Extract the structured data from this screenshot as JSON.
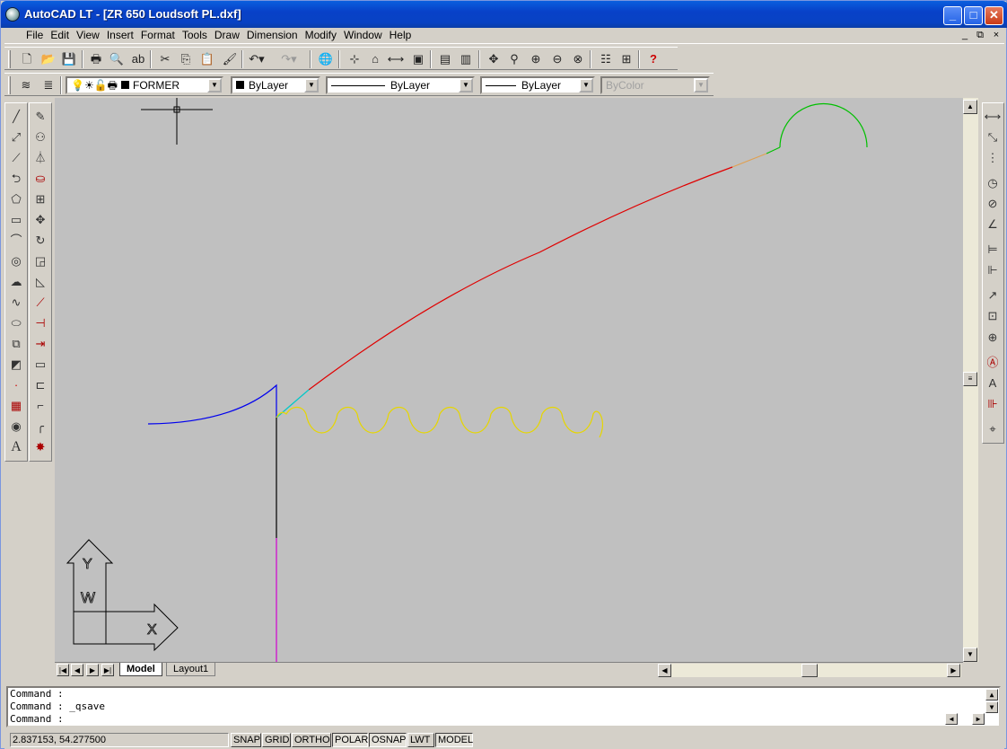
{
  "window": {
    "title": "AutoCAD LT - [ZR 650 Loudsoft PL.dxf]",
    "minimize": "_",
    "maximize": "□",
    "close": "✕"
  },
  "menu": [
    "File",
    "Edit",
    "View",
    "Insert",
    "Format",
    "Tools",
    "Draw",
    "Dimension",
    "Modify",
    "Window",
    "Help"
  ],
  "mdi": {
    "minimize": "_",
    "restore": "⧉",
    "close": "×"
  },
  "properties": {
    "layer": "FORMER",
    "color": "ByLayer",
    "linetype": "ByLayer",
    "lineweight": "ByLayer",
    "plotstyle": "ByColor"
  },
  "tabs": {
    "model": "Model",
    "layout1": "Layout1"
  },
  "command": {
    "line1": "Command :",
    "line2": "Command : _qsave",
    "line3": "Command :"
  },
  "status": {
    "coords": "2.837153, 54.277500",
    "snap": "SNAP",
    "grid": "GRID",
    "ortho": "ORTHO",
    "polar": "POLAR",
    "osnap": "OSNAP",
    "lwt": "LWT",
    "model": "MODEL"
  },
  "ucs": {
    "y": "Y",
    "w": "W",
    "x": "X"
  },
  "colors": {
    "canvas": "#c0c0c0",
    "red": "#e00000",
    "blue": "#0000ee",
    "yellow": "#e6d600",
    "green": "#00c000",
    "magenta": "#d000d0",
    "cyan": "#00c8c8",
    "orange": "#e0a050"
  }
}
